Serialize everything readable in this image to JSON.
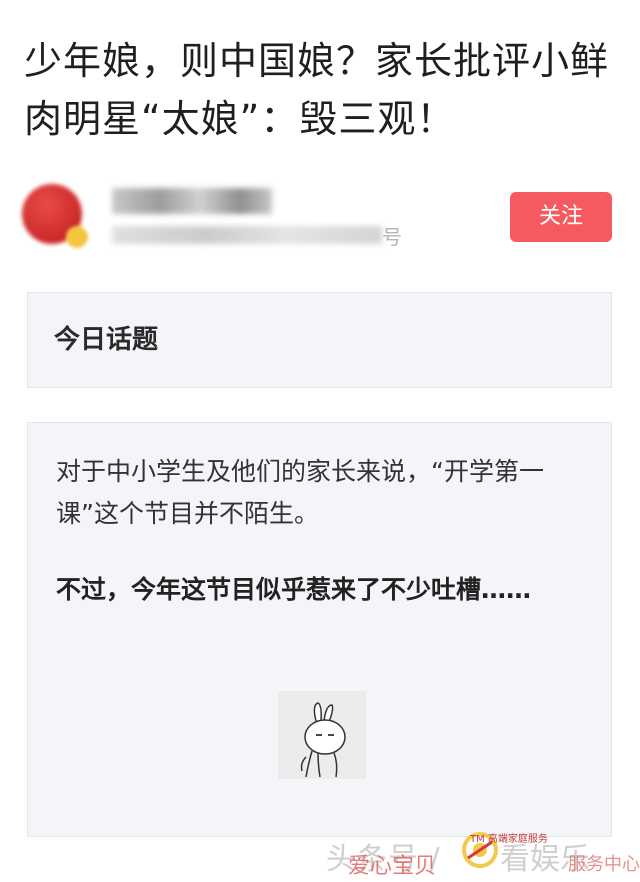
{
  "article": {
    "title": "少年娘，则中国娘？家长批评小鲜肉明星“太娘”：毁三观！"
  },
  "author": {
    "meta_suffix": "号",
    "follow_label": "关注"
  },
  "topic": {
    "label": "今日话题"
  },
  "content": {
    "paragraph1": "对于中小学生及他们的家长来说，“开学第一课”这个节目并不陌生。",
    "paragraph2": "不过，今年这节目似乎惹来了不少吐槽……",
    "sticker_icon": "rabbit-sticker-icon"
  },
  "watermark": {
    "text_left": "头条号 /",
    "text_right": "看娱乐",
    "overlay_red": "爱心宝贝",
    "overlay_red_right": "服务中心",
    "logo_small": "TM 高端家庭服务"
  }
}
